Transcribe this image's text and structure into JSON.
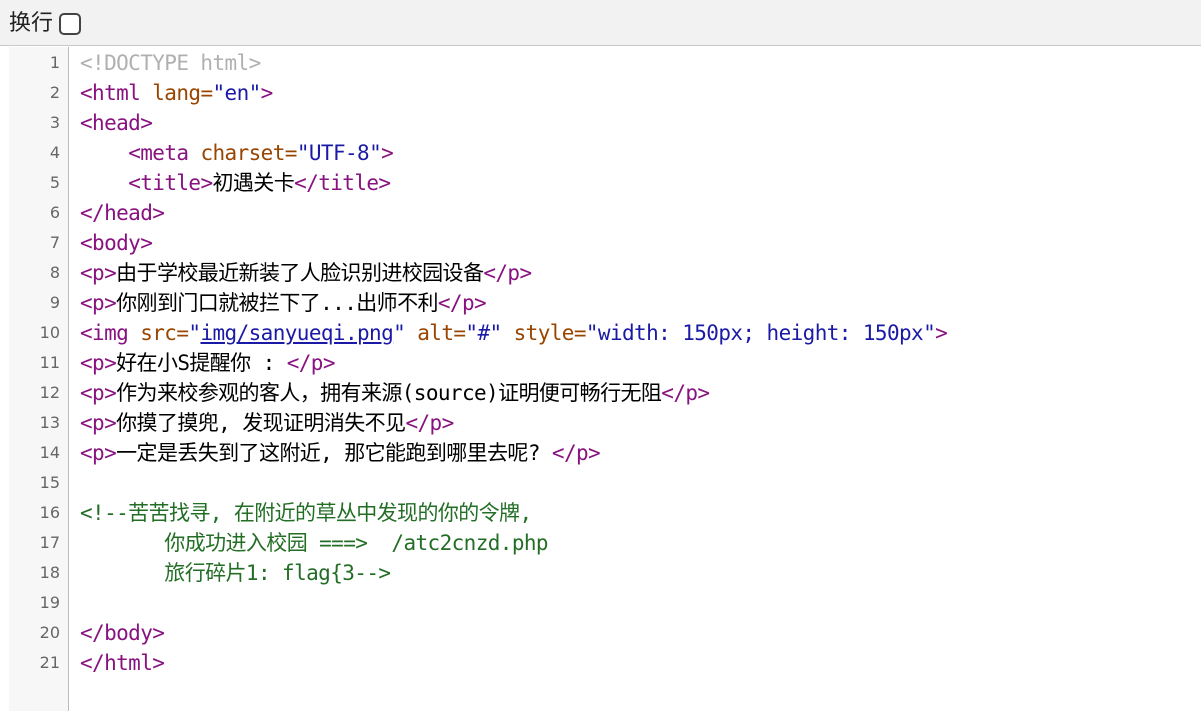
{
  "toolbar": {
    "wrap_label": "换行",
    "wrap_checked": false
  },
  "source": {
    "lines": [
      {
        "num": "1",
        "segments": [
          {
            "t": "doctype",
            "v": "<!DOCTYPE html>"
          }
        ]
      },
      {
        "num": "2",
        "segments": [
          {
            "t": "tag",
            "v": "<html "
          },
          {
            "t": "attr",
            "v": "lang="
          },
          {
            "t": "val",
            "v": "\"en\""
          },
          {
            "t": "tag",
            "v": ">"
          }
        ]
      },
      {
        "num": "3",
        "segments": [
          {
            "t": "tag",
            "v": "<head>"
          }
        ]
      },
      {
        "num": "4",
        "segments": [
          {
            "t": "text",
            "v": "    "
          },
          {
            "t": "tag",
            "v": "<meta "
          },
          {
            "t": "attr",
            "v": "charset="
          },
          {
            "t": "val",
            "v": "\"UTF-8\""
          },
          {
            "t": "tag",
            "v": ">"
          }
        ]
      },
      {
        "num": "5",
        "segments": [
          {
            "t": "text",
            "v": "    "
          },
          {
            "t": "tag",
            "v": "<title>"
          },
          {
            "t": "text",
            "v": "初遇关卡"
          },
          {
            "t": "tag",
            "v": "</title>"
          }
        ]
      },
      {
        "num": "6",
        "segments": [
          {
            "t": "tag",
            "v": "</head>"
          }
        ]
      },
      {
        "num": "7",
        "segments": [
          {
            "t": "tag",
            "v": "<body>"
          }
        ]
      },
      {
        "num": "8",
        "segments": [
          {
            "t": "tag",
            "v": "<p>"
          },
          {
            "t": "text",
            "v": "由于学校最近新装了人脸识别进校园设备"
          },
          {
            "t": "tag",
            "v": "</p>"
          }
        ]
      },
      {
        "num": "9",
        "segments": [
          {
            "t": "tag",
            "v": "<p>"
          },
          {
            "t": "text",
            "v": "你刚到门口就被拦下了...出师不利"
          },
          {
            "t": "tag",
            "v": "</p>"
          }
        ]
      },
      {
        "num": "10",
        "segments": [
          {
            "t": "tag",
            "v": "<img "
          },
          {
            "t": "attr",
            "v": "src="
          },
          {
            "t": "val",
            "v": "\""
          },
          {
            "t": "link",
            "v": "img/sanyueqi.png"
          },
          {
            "t": "val",
            "v": "\""
          },
          {
            "t": "attr",
            "v": " alt="
          },
          {
            "t": "val",
            "v": "\"#\""
          },
          {
            "t": "attr",
            "v": " style="
          },
          {
            "t": "val",
            "v": "\"width: 150px; height: 150px\""
          },
          {
            "t": "tag",
            "v": ">"
          }
        ]
      },
      {
        "num": "11",
        "segments": [
          {
            "t": "tag",
            "v": "<p>"
          },
          {
            "t": "text",
            "v": "好在小S提醒你 : "
          },
          {
            "t": "tag",
            "v": "</p>"
          }
        ]
      },
      {
        "num": "12",
        "segments": [
          {
            "t": "tag",
            "v": "<p>"
          },
          {
            "t": "text",
            "v": "作为来校参观的客人，拥有来源(source)证明便可畅行无阻"
          },
          {
            "t": "tag",
            "v": "</p>"
          }
        ]
      },
      {
        "num": "13",
        "segments": [
          {
            "t": "tag",
            "v": "<p>"
          },
          {
            "t": "text",
            "v": "你摸了摸兜, 发现证明消失不见"
          },
          {
            "t": "tag",
            "v": "</p>"
          }
        ]
      },
      {
        "num": "14",
        "segments": [
          {
            "t": "tag",
            "v": "<p>"
          },
          {
            "t": "text",
            "v": "一定是丢失到了这附近, 那它能跑到哪里去呢? "
          },
          {
            "t": "tag",
            "v": "</p>"
          }
        ]
      },
      {
        "num": "15",
        "segments": []
      },
      {
        "num": "16",
        "segments": [
          {
            "t": "comment",
            "v": "<!--苦苦找寻, 在附近的草丛中发现的你的令牌,"
          }
        ]
      },
      {
        "num": "17",
        "segments": [
          {
            "t": "comment",
            "v": "       你成功进入校园 ===>  /atc2cnzd.php"
          }
        ]
      },
      {
        "num": "18",
        "segments": [
          {
            "t": "comment",
            "v": "       旅行碎片1: flag{3-->"
          }
        ]
      },
      {
        "num": "19",
        "segments": []
      },
      {
        "num": "20",
        "segments": [
          {
            "t": "tag",
            "v": "</body>"
          }
        ]
      },
      {
        "num": "21",
        "segments": [
          {
            "t": "tag",
            "v": "</html>"
          }
        ]
      }
    ]
  }
}
